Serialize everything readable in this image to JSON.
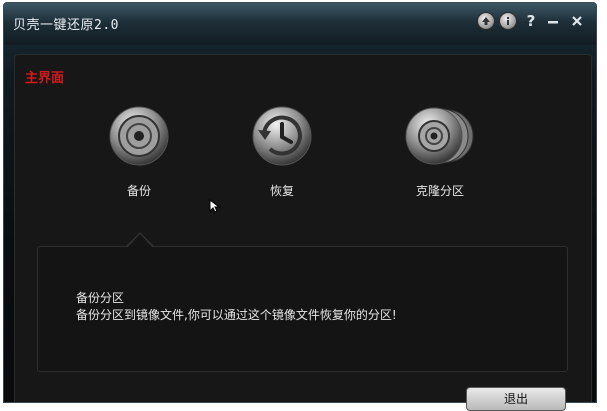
{
  "window": {
    "title": "贝壳一键还原2.0",
    "controls": [
      "upgrade-icon",
      "info-icon",
      "help-icon",
      "minimize-icon",
      "close-icon"
    ]
  },
  "main": {
    "section_title": "主界面",
    "features": [
      {
        "label": "备份",
        "icon": "disc-backup-icon"
      },
      {
        "label": "恢复",
        "icon": "restore-clock-icon"
      },
      {
        "label": "克隆分区",
        "icon": "clone-discs-icon"
      }
    ],
    "description": {
      "title": "备份分区",
      "text": "备份分区到镜像文件,你可以通过这个镜像文件恢复你的分区!"
    },
    "exit_label": "退出"
  },
  "colors": {
    "accent_red": "#d11a1a",
    "panel_bg": "#171717",
    "titlebar": "#1e2f38"
  }
}
